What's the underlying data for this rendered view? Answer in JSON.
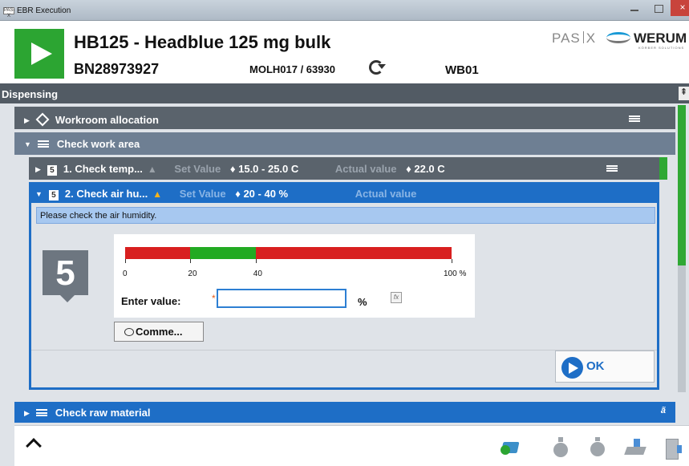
{
  "window": {
    "app_icon_text": "PAS-X",
    "title": "EBR Execution",
    "close_glyph": "×"
  },
  "header": {
    "product_title": "HB125 - Headblue 125 mg bulk",
    "batch_number": "BN28973927",
    "order_reference": "MOLH017 / 63930",
    "workroom": "WB01",
    "logo_pasx_left": "PAS",
    "logo_pasx_right": "X",
    "logo_werum": "WERUM",
    "logo_werum_sub": "KÖRBER SOLUTIONS"
  },
  "section": {
    "title": "Dispensing",
    "pin_glyph": "⇞"
  },
  "rows": {
    "workroom": {
      "label": "Workroom allocation"
    },
    "check_work_area": {
      "label": "Check work area"
    },
    "check_temp": {
      "step": "5",
      "label": "1. Check temp...",
      "set_value_label": "Set Value",
      "set_value": "15.0 - 25.0 C",
      "actual_value_label": "Actual value",
      "actual_value": "22.0 C"
    },
    "check_air": {
      "step": "5",
      "label": "2. Check air hu...",
      "set_value_label": "Set Value",
      "set_value": "20 - 40 %",
      "actual_value_label": "Actual value"
    },
    "check_raw_material": {
      "label": "Check raw material"
    }
  },
  "step_content": {
    "instruction": "Please check the air humidity.",
    "step_number": "5",
    "range": {
      "segments": [
        {
          "from": 0,
          "to": 20,
          "color": "#d81f1f"
        },
        {
          "from": 20,
          "to": 40,
          "color": "#22aa22"
        },
        {
          "from": 40,
          "to": 100,
          "color": "#d81f1f"
        }
      ],
      "tick_labels": [
        "0",
        "20",
        "40",
        "100 %"
      ]
    },
    "enter_value_label": "Enter value:",
    "required_marker": "*",
    "value": "",
    "unit": "%",
    "fx_label": "fx",
    "comment_label": "Comme...",
    "ok_label": "OK"
  },
  "colors": {
    "accent_blue": "#1e6ec6",
    "start_green": "#2ca532",
    "header_grey": "#525b64"
  },
  "icons": [
    "play-icon",
    "refresh-icon",
    "diamond-icon",
    "list-icon",
    "warning-icon",
    "menu-icon",
    "comment-icon",
    "arrow-right-icon",
    "chevron-up-icon"
  ]
}
